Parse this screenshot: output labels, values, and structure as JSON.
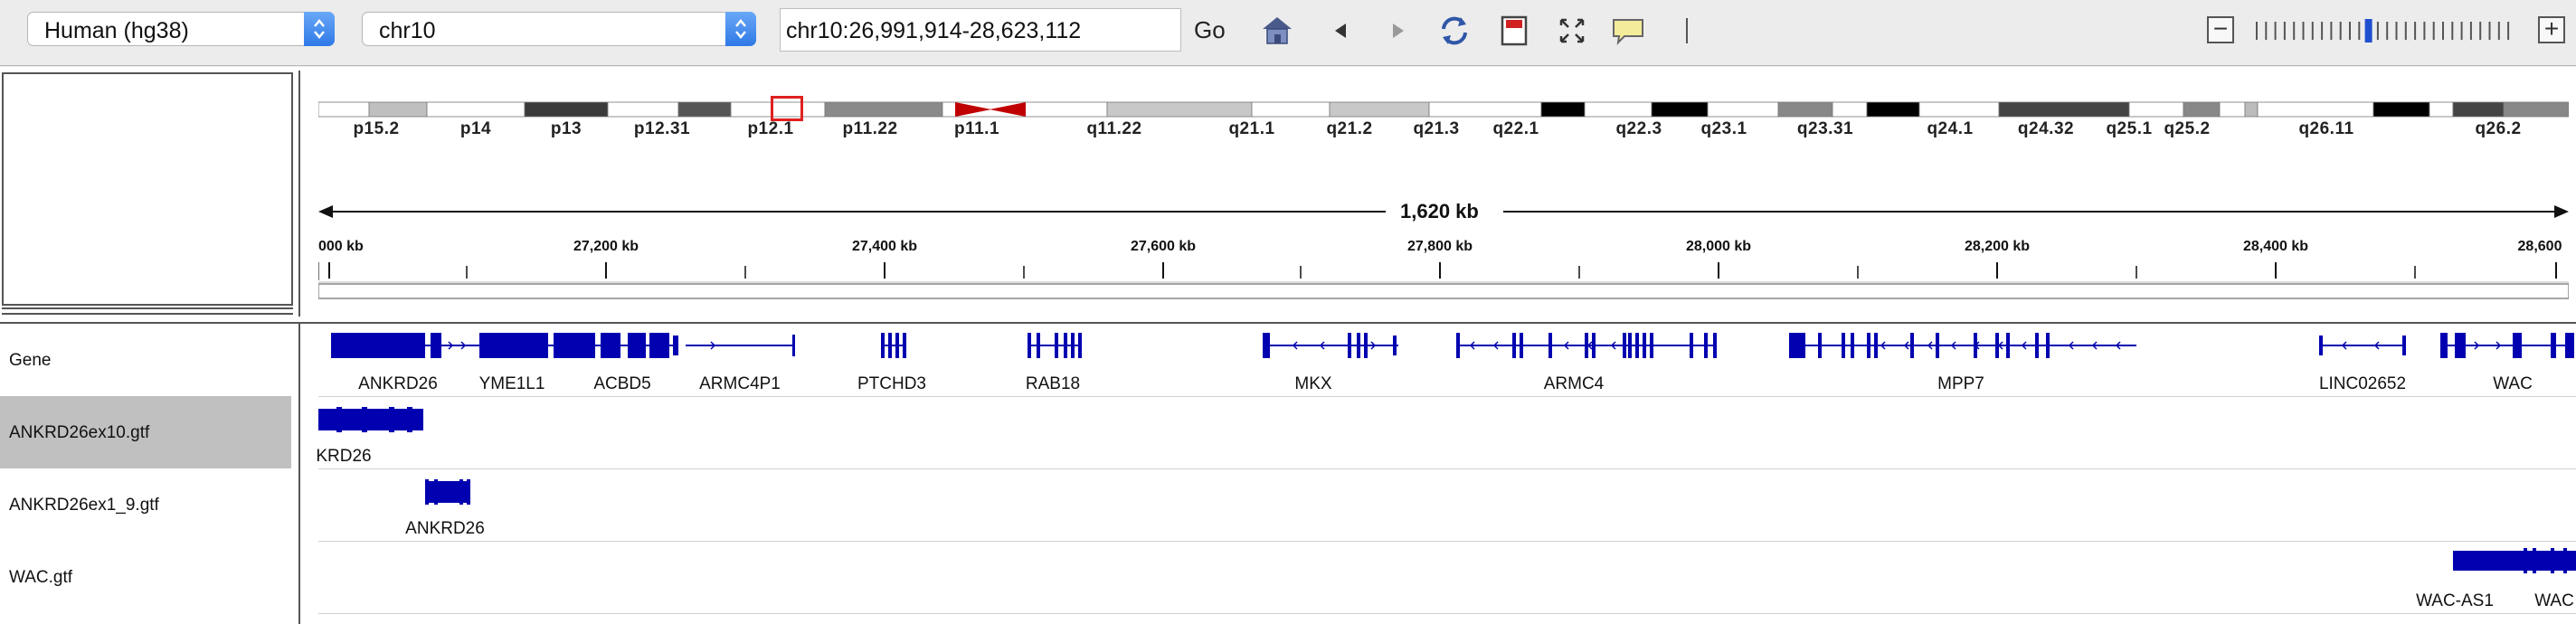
{
  "toolbar": {
    "genome": "Human (hg38)",
    "chromosome": "chr10",
    "locus": "chr10:26,991,914-28,623,112",
    "go_label": "Go"
  },
  "ideogram": {
    "bands": [
      {
        "label": "p15.2",
        "c": "#ffffff"
      },
      {
        "label": "",
        "c": "#bfbfbf"
      },
      {
        "label": "p14",
        "c": "#3a3a3a"
      },
      {
        "label": "p13",
        "c": "#ffffff"
      },
      {
        "label": "p12.31",
        "c": "#555555"
      },
      {
        "label": "p12.1",
        "c": "#8a8a8a"
      },
      {
        "label": "p11.22",
        "c": "#c8c8c8"
      },
      {
        "label": "p11.1",
        "c": "#ffffff"
      },
      {
        "label": "q11.22",
        "c": "#c8c8c8"
      },
      {
        "label": "q21.1",
        "c": "#000000"
      },
      {
        "label": "q21.2",
        "c": "#ffffff"
      },
      {
        "label": "q21.3",
        "c": "#000000"
      },
      {
        "label": "q22.1",
        "c": "#ffffff"
      },
      {
        "label": "q22.3",
        "c": "#888888"
      },
      {
        "label": "q23.1",
        "c": "#000000"
      },
      {
        "label": "q23.31",
        "c": "#444444"
      },
      {
        "label": "q24.1",
        "c": "#888888"
      },
      {
        "label": "q24.32",
        "c": "#bbbbbb"
      },
      {
        "label": "q25.1",
        "c": "#000000"
      },
      {
        "label": "q25.2",
        "c": "#ffffff"
      },
      {
        "label": "q26.11",
        "c": "#444444"
      },
      {
        "label": "q26.2",
        "c": "#888888"
      }
    ]
  },
  "ruler": {
    "span": "1,620 kb",
    "ticks": [
      "000 kb",
      "27,200 kb",
      "27,400 kb",
      "27,600 kb",
      "27,800 kb",
      "28,000 kb",
      "28,200 kb",
      "28,400 kb",
      "28,600"
    ]
  },
  "tracks": [
    {
      "name": "Gene",
      "features": [
        "ANKRD26",
        "YME1L1",
        "ACBD5",
        "ARMC4P1",
        "PTCHD3",
        "RAB18",
        "MKX",
        "ARMC4",
        "MPP7",
        "LINC02652",
        "WAC"
      ]
    },
    {
      "name": "ANKRD26ex10.gtf",
      "features": [
        "KRD26"
      ]
    },
    {
      "name": "ANKRD26ex1_9.gtf",
      "features": [
        "ANKRD26"
      ]
    },
    {
      "name": "WAC.gtf",
      "features": [
        "WAC-AS1",
        "WAC"
      ]
    }
  ],
  "colors": {
    "feature": "#0000b0",
    "selected_track": "#c0c0c0",
    "highlight": "#e02020",
    "centromere": "#c00000"
  }
}
